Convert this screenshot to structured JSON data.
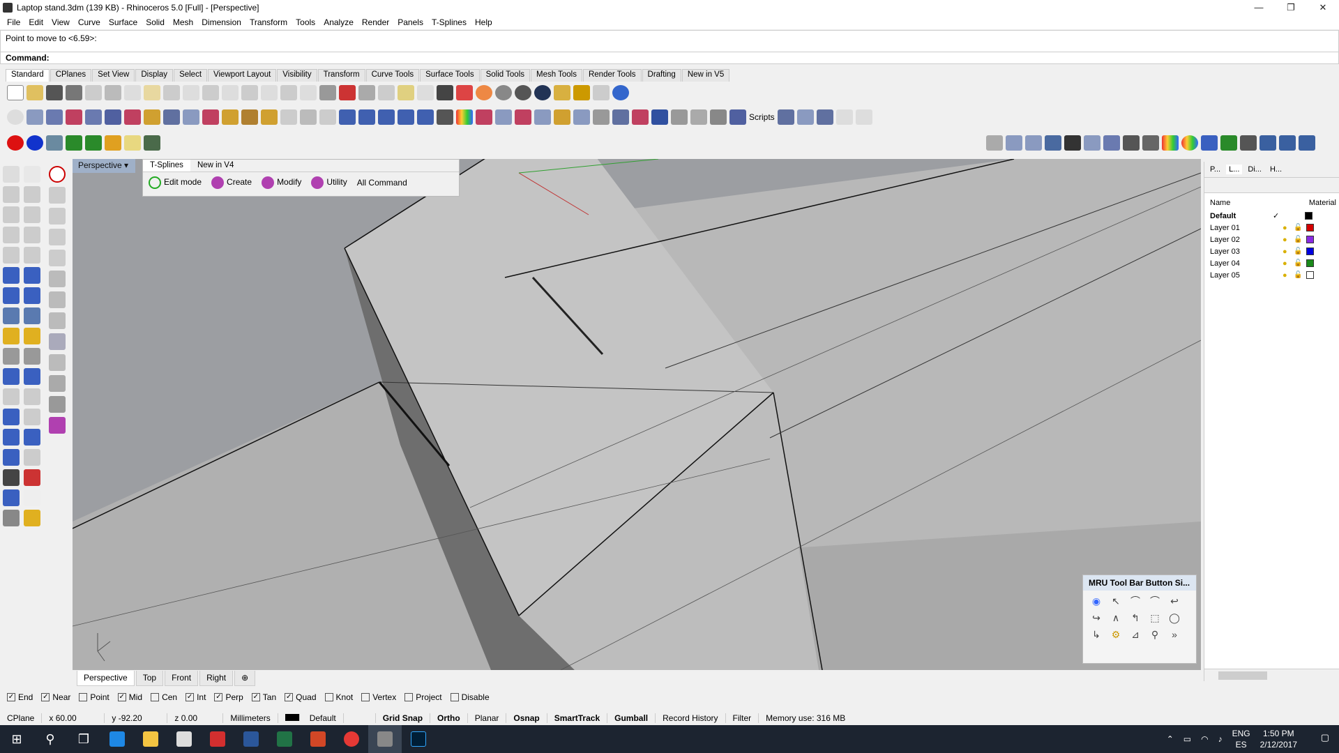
{
  "window": {
    "title": "Laptop stand.3dm (139 KB) - Rhinoceros 5.0 [Full] - [Perspective]"
  },
  "menu": [
    "File",
    "Edit",
    "View",
    "Curve",
    "Surface",
    "Solid",
    "Mesh",
    "Dimension",
    "Transform",
    "Tools",
    "Analyze",
    "Render",
    "Panels",
    "T-Splines",
    "Help"
  ],
  "command": {
    "history": "Point to move to <6.59>:",
    "prompt": "Command:"
  },
  "toolbar_tabs": [
    "Standard",
    "CPlanes",
    "Set View",
    "Display",
    "Select",
    "Viewport Layout",
    "Visibility",
    "Transform",
    "Curve Tools",
    "Surface Tools",
    "Solid Tools",
    "Mesh Tools",
    "Render Tools",
    "Drafting",
    "New in V5"
  ],
  "toolbar2": {
    "scripts_label": "Scripts"
  },
  "viewport": {
    "label": "Perspective"
  },
  "tsplines": {
    "tabs": [
      "T-Splines",
      "New in V4"
    ],
    "buttons": [
      "Edit mode",
      "Create",
      "Modify",
      "Utility",
      "All Command"
    ]
  },
  "view_tabs": [
    "Perspective",
    "Top",
    "Front",
    "Right"
  ],
  "mru": {
    "title": "MRU Tool Bar Button Si..."
  },
  "layers": {
    "tabs": [
      "P...",
      "L...",
      "Di...",
      "H..."
    ],
    "header_name": "Name",
    "header_material": "Material",
    "rows": [
      {
        "name": "Default",
        "current": "✓",
        "color": "#000000"
      },
      {
        "name": "Layer 01",
        "current": "",
        "color": "#d40000"
      },
      {
        "name": "Layer 02",
        "current": "",
        "color": "#8a2be2"
      },
      {
        "name": "Layer 03",
        "current": "",
        "color": "#0000e0"
      },
      {
        "name": "Layer 04",
        "current": "",
        "color": "#1a8a1a"
      },
      {
        "name": "Layer 05",
        "current": "",
        "color": "#ffffff"
      }
    ]
  },
  "osnap": [
    {
      "label": "End",
      "checked": true
    },
    {
      "label": "Near",
      "checked": true
    },
    {
      "label": "Point",
      "checked": false
    },
    {
      "label": "Mid",
      "checked": true
    },
    {
      "label": "Cen",
      "checked": false
    },
    {
      "label": "Int",
      "checked": true
    },
    {
      "label": "Perp",
      "checked": true
    },
    {
      "label": "Tan",
      "checked": true
    },
    {
      "label": "Quad",
      "checked": true
    },
    {
      "label": "Knot",
      "checked": false
    },
    {
      "label": "Vertex",
      "checked": false
    },
    {
      "label": "Project",
      "checked": false
    },
    {
      "label": "Disable",
      "checked": false
    }
  ],
  "status": {
    "cplane": "CPlane",
    "x": "x 60.00",
    "y": "y -92.20",
    "z": "z 0.00",
    "units": "Millimeters",
    "layer": "Default",
    "grid_snap": "Grid Snap",
    "ortho": "Ortho",
    "planar": "Planar",
    "osnap": "Osnap",
    "smarttrack": "SmartTrack",
    "gumball": "Gumball",
    "record_history": "Record History",
    "filter": "Filter",
    "memory": "Memory use: 316 MB"
  },
  "taskbar": {
    "lang1": "ENG",
    "lang2": "ES",
    "time": "1:50 PM",
    "date": "2/12/2017"
  }
}
